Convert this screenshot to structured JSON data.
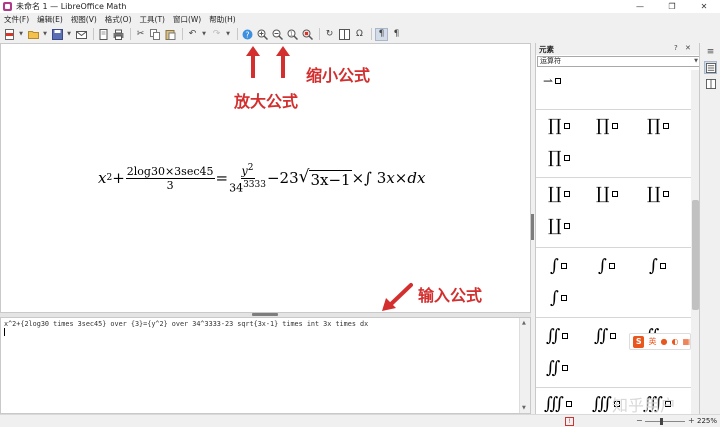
{
  "window": {
    "title": "未命名 1 — LibreOffice Math",
    "controls": {
      "minimize": "—",
      "restore": "❐",
      "close": "✕"
    }
  },
  "menu": [
    "文件(F)",
    "编辑(E)",
    "视图(V)",
    "格式(O)",
    "工具(T)",
    "窗口(W)",
    "帮助(H)"
  ],
  "toolbar": {
    "icons": [
      "export-pdf",
      "open-folder",
      "save",
      "email",
      "page-preview",
      "print",
      "cut",
      "copy",
      "paste",
      "undo",
      "redo",
      "update",
      "zoom-in",
      "zoom-out",
      "zoom-100",
      "show-all",
      "refresh",
      "formula-cursor",
      "symbols",
      "auto-update",
      "formula-display"
    ]
  },
  "formula": {
    "x": "x",
    "exp2": "2",
    "plus": "+",
    "frac1_num": "2log30×3sec45",
    "frac1_den": "3",
    "eq": "=",
    "frac2_num": "y",
    "frac2_num_exp": "2",
    "frac2_den": "34",
    "frac2_den_exp": "3333",
    "minus23": "−23",
    "sqrt_body": "3x−1",
    "times_int": "×∫ 3",
    "x2": "x",
    "times": "×",
    "dx": "dx"
  },
  "annotations": {
    "zoom_out": "缩小公式",
    "zoom_in": "放大公式",
    "input": "输入公式",
    "color": "#d32f2f"
  },
  "command": {
    "text": "x^2+{2log30 times 3sec45} over {3}={y^2} over 34^3333-23 sqrt{3x-1} times int 3x times dx"
  },
  "status": {
    "zoom": "225%",
    "zoom_minus": "−",
    "zoom_plus": "+"
  },
  "sidebar": {
    "title": "元素",
    "help": "?",
    "close": "✕",
    "more": "≡",
    "category": "运算符",
    "deck": [
      "properties-icon",
      "elements-icon"
    ]
  },
  "ime": {
    "logo": "S",
    "label": "英"
  },
  "watermark": "知乎用户"
}
